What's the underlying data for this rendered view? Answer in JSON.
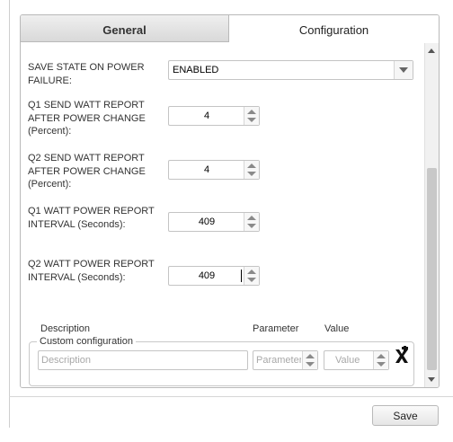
{
  "tabs": {
    "general": "General",
    "configuration": "Configuration"
  },
  "fields": {
    "save_state": {
      "label": "SAVE STATE ON POWER FAILURE:",
      "value": "ENABLED"
    },
    "q1_watt_report": {
      "label": "Q1 SEND WATT REPORT AFTER POWER CHANGE (Percent):",
      "value": "4"
    },
    "q2_watt_report": {
      "label": "Q2 SEND WATT REPORT AFTER POWER CHANGE (Percent):",
      "value": "4"
    },
    "q1_interval": {
      "label": "Q1 WATT POWER REPORT INTERVAL (Seconds):",
      "value": "409"
    },
    "q2_interval": {
      "label": "Q2 WATT POWER REPORT INTERVAL (Seconds):",
      "value": "409"
    }
  },
  "custom": {
    "legend": "Custom configuration",
    "description_label": "Description",
    "description_placeholder": "Description",
    "parameter_label": "Parameter",
    "parameter_placeholder": "Parameter",
    "value_label": "Value",
    "value_placeholder": "Value"
  },
  "footer": {
    "save_label": "Save"
  },
  "icons": {
    "add": "add-config-icon"
  }
}
